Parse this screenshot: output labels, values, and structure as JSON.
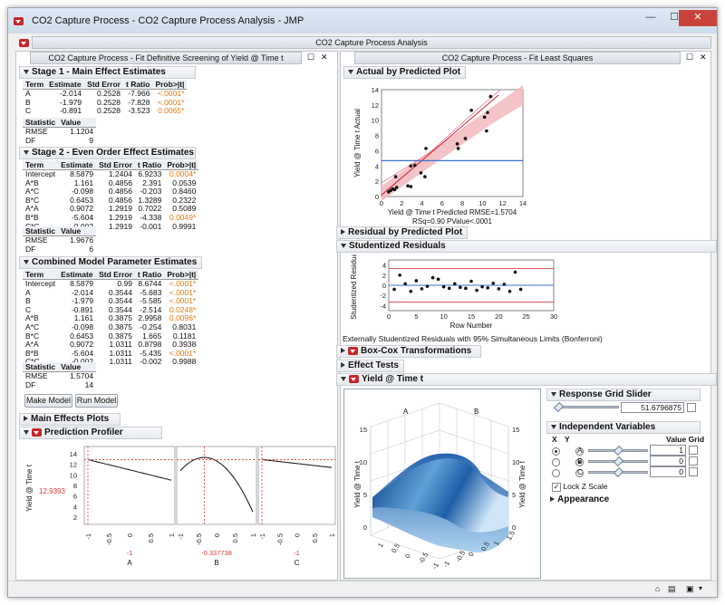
{
  "window": {
    "title": "CO2 Capture Process - CO2 Capture Process Analysis - JMP",
    "min": "—",
    "max": "☐",
    "close": "✕"
  },
  "report_title": "CO2 Capture Process Analysis",
  "left": {
    "title": "CO2 Capture Process - Fit Definitive Screening of Yield @ Time t",
    "stage1": {
      "title": "Stage 1 - Main Effect Estimates",
      "headers": [
        "Term",
        "Estimate",
        "Std Error",
        "t Ratio",
        "Prob>|t|"
      ],
      "rows": [
        [
          "A",
          "-2.014",
          "0.2528",
          "-7.966",
          "<.0001*"
        ],
        [
          "B",
          "-1.979",
          "0.2528",
          "-7.828",
          "<.0001*"
        ],
        [
          "C",
          "-0.891",
          "0.2528",
          "-3.523",
          "0.0065*"
        ]
      ],
      "stat_headers": [
        "Statistic",
        "Value"
      ],
      "stats": [
        [
          "RMSE",
          "1.1204"
        ],
        [
          "DF",
          "9"
        ]
      ]
    },
    "stage2": {
      "title": "Stage 2 - Even Order Effect Estimates",
      "headers": [
        "Term",
        "Estimate",
        "Std Error",
        "t Ratio",
        "Prob>|t|"
      ],
      "rows": [
        [
          "Intercept",
          "8.5879",
          "1.2404",
          "6.9233",
          "0.0004*"
        ],
        [
          "A*B",
          "1.161",
          "0.4856",
          "2.391",
          "0.0539"
        ],
        [
          "A*C",
          "-0.098",
          "0.4856",
          "-0.203",
          "0.8460"
        ],
        [
          "B*C",
          "0.6453",
          "0.4856",
          "1.3289",
          "0.2322"
        ],
        [
          "A*A",
          "0.9072",
          "1.2919",
          "0.7022",
          "0.5089"
        ],
        [
          "B*B",
          "-5.604",
          "1.2919",
          "-4.338",
          "0.0049*"
        ],
        [
          "C*C",
          "-0.002",
          "1.2919",
          "-0.001",
          "0.9991"
        ]
      ],
      "stat_headers": [
        "Statistic",
        "Value"
      ],
      "stats": [
        [
          "RMSE",
          "1.9676"
        ],
        [
          "DF",
          "6"
        ]
      ]
    },
    "combined": {
      "title": "Combined Model Parameter Estimates",
      "headers": [
        "Term",
        "Estimate",
        "Std Error",
        "t Ratio",
        "Prob>|t|"
      ],
      "rows": [
        [
          "Intercept",
          "8.5879",
          "0.99",
          "8.6744",
          "<.0001*"
        ],
        [
          "A",
          "-2.014",
          "0.3544",
          "-5.683",
          "<.0001*"
        ],
        [
          "B",
          "-1.979",
          "0.3544",
          "-5.585",
          "<.0001*"
        ],
        [
          "C",
          "-0.891",
          "0.3544",
          "-2.514",
          "0.0248*"
        ],
        [
          "A*B",
          "1.161",
          "0.3875",
          "2.9958",
          "0.0096*"
        ],
        [
          "A*C",
          "-0.098",
          "0.3875",
          "-0.254",
          "0.8031"
        ],
        [
          "B*C",
          "0.6453",
          "0.3875",
          "1.665",
          "0.1181"
        ],
        [
          "A*A",
          "0.9072",
          "1.0311",
          "0.8798",
          "0.3938"
        ],
        [
          "B*B",
          "-5.604",
          "1.0311",
          "-5.435",
          "<.0001*"
        ],
        [
          "C*C",
          "-0.002",
          "1.0311",
          "-0.002",
          "0.9988"
        ]
      ],
      "stat_headers": [
        "Statistic",
        "Value"
      ],
      "stats": [
        [
          "RMSE",
          "1.5704"
        ],
        [
          "DF",
          "14"
        ]
      ]
    },
    "make_model": "Make Model",
    "run_model": "Run Model",
    "main_effects": "Main Effects Plots",
    "profiler": {
      "title": "Prediction Profiler",
      "ylabel": "Yield @ Time t",
      "yvalue": "12.9393",
      "yticks": [
        "14",
        "12",
        "10",
        "8",
        "6",
        "4",
        "2"
      ],
      "xticks": [
        "-1",
        "-0.5",
        "0",
        "0.5",
        "1"
      ],
      "factors": [
        {
          "name": "A",
          "value": "-1"
        },
        {
          "name": "B",
          "value": "-0.337738"
        },
        {
          "name": "C",
          "value": "-1"
        }
      ]
    }
  },
  "right": {
    "title": "CO2 Capture Process - Fit Least Squares",
    "avp": {
      "title": "Actual by Predicted Plot",
      "ylabel": "Yield @ Time t Actual",
      "xlabel": "Yield @ Time t Predicted RMSE=1.5704",
      "sub": "RSq=0.90 PValue<.0001",
      "ticks": [
        "0",
        "2",
        "4",
        "6",
        "8",
        "10",
        "12",
        "14"
      ]
    },
    "resid_pred": "Residual by Predicted Plot",
    "stud": {
      "title": "Studentized Residuals",
      "ylabel": "Studentized Residual",
      "xlabel": "Row Number",
      "yticks": [
        "4",
        "2",
        "0",
        "-2",
        "-4"
      ],
      "xticks": [
        "0",
        "5",
        "10",
        "15",
        "20",
        "25",
        "30"
      ],
      "note": "Externally Studentized Residuals with 95% Simultaneous Limits (Bonferroni)"
    },
    "boxcox": "Box-Cox Transformations",
    "effect": "Effect Tests",
    "yield": "Yield @ Time t",
    "surface": {
      "axisA": "A",
      "axisB": "B",
      "zlabel": "Yield @ Time t",
      "ticks1": [
        "1",
        "0.5",
        "0",
        "-0.5",
        "-1"
      ],
      "ticks2": [
        "-1",
        "-0.5",
        "0",
        "0.5",
        "1",
        "1.5"
      ],
      "zticks": [
        "15",
        "10",
        "5",
        "0"
      ]
    },
    "grid": {
      "title": "Response Grid Slider",
      "value": "51.6796875"
    },
    "indep": {
      "title": "Independent Variables",
      "col_x": "X",
      "col_y": "Y",
      "col_vg": "Value Grid",
      "vars": [
        {
          "name": "A",
          "value": "1"
        },
        {
          "name": "B",
          "value": "0"
        },
        {
          "name": "C",
          "value": "0"
        }
      ]
    },
    "lockz": "Lock Z Scale",
    "appearance": "Appearance"
  },
  "chart_data": [
    {
      "type": "scatter",
      "title": "Actual by Predicted Plot",
      "xlabel": "Yield @ Time t Predicted RMSE=1.5704",
      "ylabel": "Yield @ Time t Actual",
      "xlim": [
        0,
        14
      ],
      "ylim": [
        0,
        14
      ],
      "points": [
        [
          0.7,
          0.6
        ],
        [
          0.9,
          0.8
        ],
        [
          1.1,
          1.0
        ],
        [
          1.3,
          0.9
        ],
        [
          1.5,
          1.2
        ],
        [
          1.4,
          2.6
        ],
        [
          2.6,
          1.4
        ],
        [
          2.9,
          1.3
        ],
        [
          2.9,
          4.0
        ],
        [
          3.3,
          4.1
        ],
        [
          3.9,
          3.1
        ],
        [
          4.3,
          2.6
        ],
        [
          4.4,
          6.3
        ],
        [
          7.5,
          6.9
        ],
        [
          7.6,
          6.3
        ],
        [
          8.3,
          7.6
        ],
        [
          8.9,
          11.3
        ],
        [
          10.4,
          8.6
        ],
        [
          10.2,
          10.4
        ],
        [
          10.5,
          11.0
        ],
        [
          10.8,
          13.1
        ]
      ],
      "mean": 4.7
    },
    {
      "type": "scatter",
      "title": "Studentized Residuals",
      "xlabel": "Row Number",
      "ylabel": "Studentized Residual",
      "xlim": [
        0,
        30
      ],
      "ylim": [
        -5,
        5
      ],
      "limits": [
        3.3,
        -3.3
      ],
      "points": [
        [
          1,
          -0.8
        ],
        [
          2,
          2.0
        ],
        [
          3,
          0.3
        ],
        [
          4,
          -1.2
        ],
        [
          5,
          0.9
        ],
        [
          6,
          -0.7
        ],
        [
          7,
          -0.2
        ],
        [
          8,
          1.5
        ],
        [
          9,
          1.2
        ],
        [
          10,
          -0.3
        ],
        [
          11,
          -0.6
        ],
        [
          12,
          0.3
        ],
        [
          13,
          -0.4
        ],
        [
          14,
          -0.6
        ],
        [
          15,
          0.8
        ],
        [
          16,
          -1.0
        ],
        [
          17,
          -0.3
        ],
        [
          18,
          -0.5
        ],
        [
          19,
          0.4
        ],
        [
          20,
          -0.7
        ],
        [
          21,
          0.2
        ],
        [
          22,
          -1.2
        ],
        [
          23,
          2.6
        ],
        [
          24,
          -0.8
        ]
      ]
    }
  ]
}
